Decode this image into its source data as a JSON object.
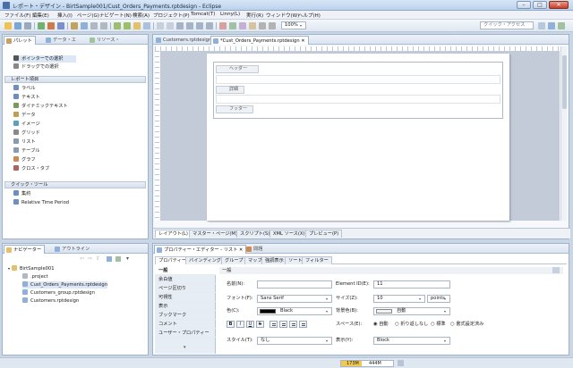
{
  "window": {
    "title": "レポート・デザイン - BirtSample001/Cust_Orders_Payments.rptdesign - Eclipse",
    "min": "–",
    "max": "□",
    "close": "✕"
  },
  "menu": [
    "ファイル(F)",
    "編集(E)",
    "挿入(I)",
    "ページ(G)",
    "ナビゲート(N)",
    "検索(A)",
    "プロジェクト(P)",
    "Tomcat(T)",
    "Linny(L)",
    "実行(R)",
    "ウィンドウ(W)",
    "ヘルプ(H)"
  ],
  "toolbar": {
    "zoom": "100%",
    "quick_access": "クイック・アクセス"
  },
  "palette": {
    "tabs": [
      "パレット",
      "データ・エ",
      "リソース・"
    ],
    "pointer": [
      "ポインターでの選択",
      "ドラッグでの選択"
    ],
    "report_items_header": "レポート項目",
    "items": [
      "ラベル",
      "テキスト",
      "ダイナミックテキスト",
      "データ",
      "イメージ",
      "グリッド",
      "リスト",
      "テーブル",
      "グラフ",
      "クロス・タブ"
    ],
    "quick_tools_header": "クイック・ツール",
    "tools": [
      "集約",
      "Relative Time Period"
    ]
  },
  "editor": {
    "tabs": [
      "Customers.rptdesign",
      "*Cust_Orders_Payments.rptdesign"
    ],
    "bands": [
      "ヘッダー",
      "詳細",
      "フッター"
    ],
    "bottom_tabs": [
      "レイアウト(L)",
      "マスター・ページ(M)",
      "スクリプト(S)",
      "XML ソース(X)",
      "プレビュー(P)"
    ]
  },
  "navigator": {
    "tabs": [
      "ナビゲーター",
      "アウトライン"
    ],
    "project": "BirtSample001",
    "files": [
      ".project",
      "Cust_Orders_Payments.rptdesign",
      "Customers_group.rptdesign",
      "Customers.rptdesign"
    ]
  },
  "properties": {
    "tabs": [
      "プロパティー・エディター - リスト",
      "問題"
    ],
    "subtabs": [
      "プロパティー",
      "バインディング",
      "グループ",
      "マップ",
      "強調表示",
      "ソート",
      "フィルター"
    ],
    "side": [
      "一般",
      "余白値",
      "ページ区切り",
      "可視性",
      "表示",
      "ブックマーク",
      "コメント",
      "ユーザー・プロパティー"
    ],
    "section": "一般",
    "name_label": "名前(N):",
    "name_value": "",
    "element_id_label": "Element ID(E):",
    "element_id_value": "11",
    "font_label": "フォント(F):",
    "font_value": "Sans Serif",
    "size_label": "サイズ(Z):",
    "size_value": "10",
    "size_unit": "points",
    "color_label": "色(C):",
    "color_value": "Black",
    "color_hex": "#000000",
    "bgcolor_label": "背景色(B):",
    "bgcolor_value": "自動",
    "space_label": "スペース(E):",
    "space_options": [
      "自動",
      "折り返しなし",
      "標準",
      "書式設定済み"
    ],
    "style_label": "スタイル(T):",
    "style_value": "なし",
    "display_label": "表示(Y):",
    "display_value": "Block",
    "format_buttons": [
      "B",
      "I",
      "U",
      "S"
    ]
  },
  "status": {
    "heap": "173M",
    "of": "444M"
  }
}
